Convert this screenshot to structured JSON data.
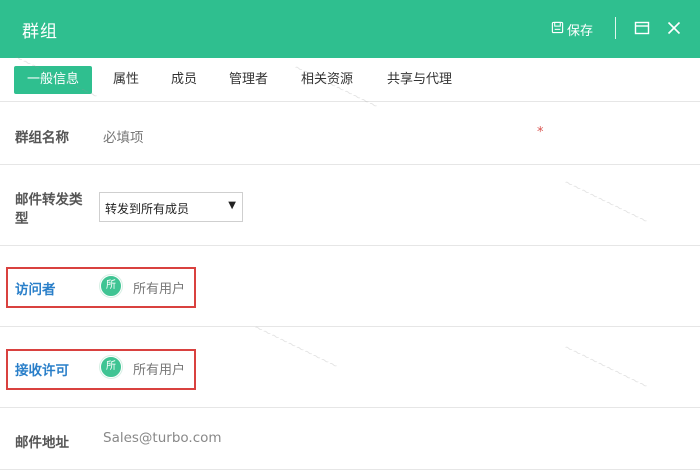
{
  "window": {
    "title": "群组",
    "save_label": "保存"
  },
  "tabs": [
    {
      "label": "一般信息",
      "active": true
    },
    {
      "label": "属性"
    },
    {
      "label": "成员"
    },
    {
      "label": "管理者"
    },
    {
      "label": "相关资源"
    },
    {
      "label": "共享与代理"
    }
  ],
  "form": {
    "group_name": {
      "label": "群组名称",
      "placeholder": "必填项",
      "required_mark": "*"
    },
    "mail_forward": {
      "label_line1": "邮件转发类",
      "label_line2": "型",
      "selected": "转发到所有成员"
    },
    "visitor": {
      "label": "访问者",
      "avatar_text": "所",
      "value": "所有用户"
    },
    "receive": {
      "label": "接收许可",
      "avatar_text": "所",
      "value": "所有用户"
    },
    "email": {
      "label": "邮件地址",
      "value": "Sales@turbo.com"
    }
  },
  "colors": {
    "header": "#2fbf8f",
    "accent_label": "#2a7fc9",
    "highlight_box": "#d9413f",
    "required": "#d9534f"
  },
  "icons": [
    "save-icon",
    "maximize-icon",
    "close-icon",
    "avatar-icon"
  ]
}
